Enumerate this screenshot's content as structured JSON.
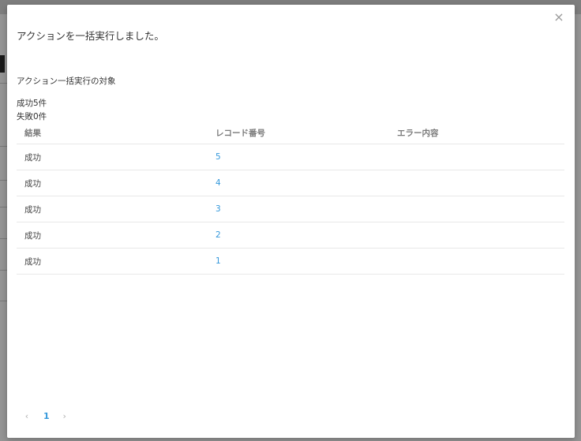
{
  "modal": {
    "close_label": "×",
    "title": "アクションを一括実行しました。",
    "section_label": "アクション一括実行の対象",
    "success_summary": "成功5件",
    "failure_summary": "失敗0件"
  },
  "table": {
    "headers": [
      "結果",
      "レコード番号",
      "エラー内容"
    ],
    "rows": [
      {
        "result": "成功",
        "record": "5",
        "error": ""
      },
      {
        "result": "成功",
        "record": "4",
        "error": ""
      },
      {
        "result": "成功",
        "record": "3",
        "error": ""
      },
      {
        "result": "成功",
        "record": "2",
        "error": ""
      },
      {
        "result": "成功",
        "record": "1",
        "error": ""
      }
    ]
  },
  "pagination": {
    "prev": "‹",
    "current_page": "1",
    "next": "›"
  },
  "colors": {
    "accent": "#3498db",
    "overlay": "rgba(0,0,0,0.42)"
  }
}
